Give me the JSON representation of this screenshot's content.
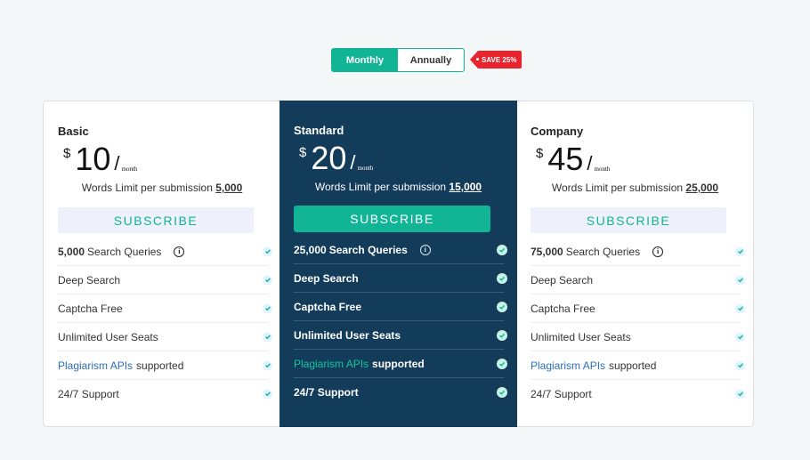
{
  "billing_toggle": {
    "monthly": "Monthly",
    "annually": "Annually",
    "active": "monthly"
  },
  "save_badge": "SAVE 25%",
  "colors": {
    "accent": "#11b596",
    "highlight_bg": "#133c5a",
    "badge": "#e8252f",
    "link": "#2a6fb7"
  },
  "plans": [
    {
      "name": "Basic",
      "currency": "$",
      "price": "10",
      "slash": "/",
      "period": "month",
      "limit_label": "Words Limit per submission",
      "limit_value": "5,000",
      "subscribe": "SUBSCRIBE",
      "features": {
        "queries_count": "5,000",
        "queries_label": "Search Queries",
        "deep": "Deep Search",
        "captcha": "Captcha Free",
        "seats": "Unlimited User Seats",
        "api_link": "Plagiarism APIs",
        "api_suffix": "supported",
        "support": "24/7 Support"
      }
    },
    {
      "name": "Standard",
      "currency": "$",
      "price": "20",
      "slash": "/",
      "period": "month",
      "limit_label": "Words Limit per submission",
      "limit_value": "15,000",
      "subscribe": "SUBSCRIBE",
      "features": {
        "queries_count": "25,000",
        "queries_label": "Search Queries",
        "deep": "Deep Search",
        "captcha": "Captcha Free",
        "seats": "Unlimited User Seats",
        "api_link": "Plagiarism APIs",
        "api_suffix": "supported",
        "support": "24/7 Support"
      }
    },
    {
      "name": "Company",
      "currency": "$",
      "price": "45",
      "slash": "/",
      "period": "month",
      "limit_label": "Words Limit per submission",
      "limit_value": "25,000",
      "subscribe": "SUBSCRIBE",
      "features": {
        "queries_count": "75,000",
        "queries_label": "Search Queries",
        "deep": "Deep Search",
        "captcha": "Captcha Free",
        "seats": "Unlimited User Seats",
        "api_link": "Plagiarism APIs",
        "api_suffix": "supported",
        "support": "24/7 Support"
      }
    }
  ],
  "icons": {
    "info": "info-icon",
    "check": "check-circle-icon"
  },
  "info_glyph": "i"
}
